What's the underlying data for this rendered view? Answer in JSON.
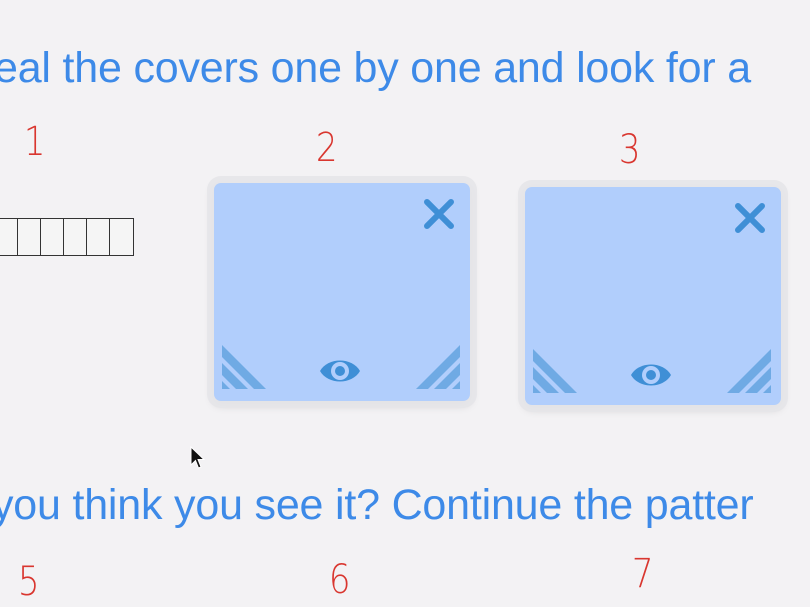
{
  "instructions": {
    "top": "eal the covers one by one and look for a",
    "bottom": "you think you see it? Continue the patter"
  },
  "numbers": [
    "1",
    "2",
    "3",
    "5",
    "6",
    "7"
  ],
  "strip": {
    "cells": 7
  },
  "covers": [
    {
      "close_icon": "close-icon",
      "reveal_icon": "eye-icon"
    },
    {
      "close_icon": "close-icon",
      "reveal_icon": "eye-icon"
    }
  ],
  "colors": {
    "accent": "#3d8ae8",
    "number_red": "#d9362f",
    "cover_fill": "#b1cefc",
    "icon_blue": "#3f8fd6",
    "background": "#f3f2f4"
  }
}
